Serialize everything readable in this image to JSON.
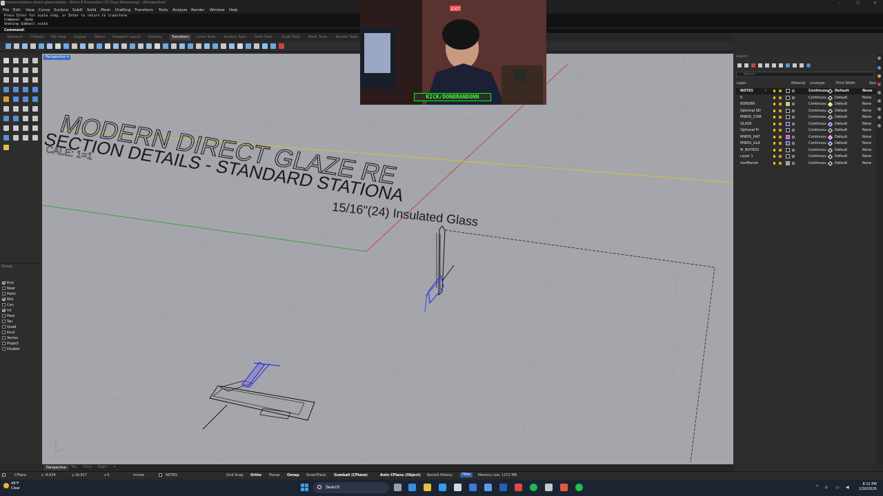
{
  "window": {
    "title": "marvin-modern-direct-glaze-details - Rhino 8 Evaluation (70 Days Remaining) - [Perspective]",
    "controls": [
      "–",
      "☐",
      "✕"
    ]
  },
  "menu": [
    "File",
    "Edit",
    "View",
    "Curve",
    "Surface",
    "SubD",
    "Solid",
    "Mesh",
    "Drafting",
    "Transform",
    "Tools",
    "Analyze",
    "Render",
    "Window",
    "Help"
  ],
  "command_history": [
    "Press Enter for scale step, or Enter to return to transform",
    "Command: _Undo",
    "Undoing Gumball scale"
  ],
  "command_prompt": "Command:",
  "toolbar_tabs": [
    "Standard",
    "CPlanes",
    "Set View",
    "Display",
    "Select",
    "Viewport Layout",
    "Visibility",
    "Transform",
    "Curve Tools",
    "Surface Tools",
    "Solid Tools",
    "SubD Tools",
    "Mesh Tools",
    "Render Tools"
  ],
  "active_toolbar_tab": "Transform",
  "viewport": {
    "label": "Perspective",
    "dropdown": "▾",
    "drawing_title": "MODERN DIRECT GLAZE RE",
    "drawing_subtitle": "SECTION DETAILS - STANDARD STATIONA",
    "drawing_scale": "CALE: 1=1",
    "annotation": "15/16\"(24) Insulated Glass"
  },
  "webcam": {
    "banner": "KICK/DONBRANDONN",
    "exit_sign": "EXIT"
  },
  "osnap": {
    "title": "Osnap",
    "items": [
      {
        "label": "End",
        "checked": true
      },
      {
        "label": "Near",
        "checked": false
      },
      {
        "label": "Point",
        "checked": false
      },
      {
        "label": "Mid",
        "checked": true
      },
      {
        "label": "Cen",
        "checked": false
      },
      {
        "label": "Int",
        "checked": true
      },
      {
        "label": "Perp",
        "checked": false
      },
      {
        "label": "Tan",
        "checked": false
      },
      {
        "label": "Quad",
        "checked": false
      },
      {
        "label": "Knot",
        "checked": false
      },
      {
        "label": "Vertex",
        "checked": false
      },
      {
        "label": "Project",
        "checked": false
      },
      {
        "label": "Disable",
        "checked": false
      }
    ]
  },
  "layers": {
    "title": "Layers",
    "search_placeholder": "Search",
    "columns": [
      "Layer",
      "Material",
      "Linetype",
      "Print Width",
      "Sectio"
    ],
    "rows": [
      {
        "name": "NOTES",
        "color": "#1b1b1b",
        "linetype": "Continuou",
        "print_color": "Default",
        "width": "None",
        "current": true
      },
      {
        "name": "0",
        "color": "#1b1b1b",
        "linetype": "Continuou",
        "print_color": "Default",
        "width": "None",
        "current": false
      },
      {
        "name": "BORDER",
        "color": "#f0d020",
        "linetype": "Continuou",
        "print_color": "Default",
        "width": "None",
        "current": false
      },
      {
        "name": "Optional SD",
        "color": "#1b1b1b",
        "linetype": "Continuou",
        "print_color": "Default",
        "width": "None",
        "current": false
      },
      {
        "name": "MWDS_COM",
        "color": "#1b1b1b",
        "linetype": "Continuou",
        "print_color": "Default",
        "width": "None",
        "current": false
      },
      {
        "name": "GLASS",
        "color": "#2a2ae0",
        "linetype": "Continuou",
        "print_color": "Default",
        "width": "None",
        "current": false
      },
      {
        "name": "Optional Fr",
        "color": "#1b1b1b",
        "linetype": "Continuou",
        "print_color": "Default",
        "width": "None",
        "current": false
      },
      {
        "name": "MWDS_HAT",
        "color": "#e040e0",
        "linetype": "Continuou",
        "print_color": "Default",
        "width": "None",
        "current": false
      },
      {
        "name": "MWDS_GLA",
        "color": "#3a3aff",
        "linetype": "Continuou",
        "print_color": "Default",
        "width": "None",
        "current": false
      },
      {
        "name": "M_NOTES3",
        "color": "#1b1b1b",
        "linetype": "Continuou",
        "print_color": "Default",
        "width": "None",
        "current": false
      },
      {
        "name": "Layer 1",
        "color": "#1b1b1b",
        "linetype": "Continuou",
        "print_color": "Default",
        "width": "None",
        "current": false
      },
      {
        "name": "nonMarvin",
        "color": "#9a9a9a",
        "linetype": "Continuou",
        "print_color": "Default",
        "width": "None",
        "current": false
      }
    ]
  },
  "viewport_tabs": [
    "Perspective",
    "Top",
    "Front",
    "Right",
    "+"
  ],
  "status": {
    "cplane": "CPlane",
    "x": "x -8.639",
    "y": "y 16.917",
    "z": "z 0",
    "units": "Inches",
    "layer": "NOTES",
    "grid_snap": "Grid Snap",
    "ortho": "Ortho",
    "planar": "Planar",
    "osnap": "Osnap",
    "smarttrack": "SmartTrack",
    "gumball": "Gumball (CPlane)",
    "auto_cplane": "Auto CPlane (Object)",
    "record_history": "Record History",
    "filter": "Filter",
    "memory": "Memory use: 1172 MB"
  },
  "taskbar": {
    "temperature": "49°F",
    "weather": "Clear",
    "search": "Search",
    "time": "8:12 PM",
    "date": "1/18/2026"
  },
  "colors": {
    "accent": "#3a6fc4",
    "viewport_bg": "#a4a6ab",
    "osnap_green": "#38ff38"
  }
}
